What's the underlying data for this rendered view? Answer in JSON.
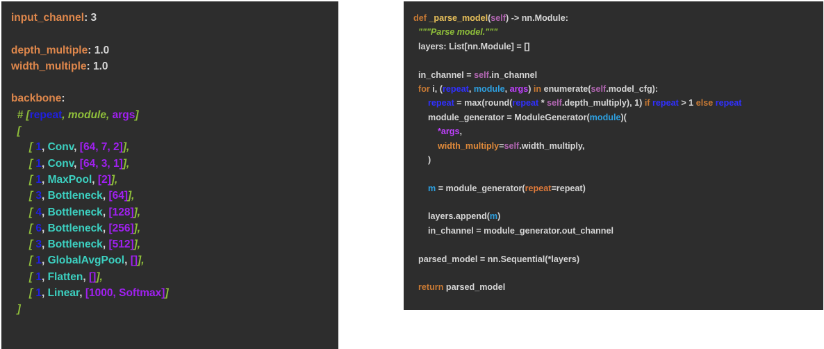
{
  "colors": {
    "panel_bg": "#2d2d2d",
    "key": "#e0884c",
    "text": "#d6d6d6",
    "comment": "#8fbf3a",
    "number": "#2020e0",
    "list": "#a020f0",
    "module": "#3cd0c0"
  },
  "yaml_lines": [
    [
      {
        "t": "input_channel",
        "c": "key"
      },
      {
        "t": ": 3",
        "c": "text"
      }
    ],
    [],
    [
      {
        "t": "depth_multiple",
        "c": "key"
      },
      {
        "t": ": 1.0",
        "c": "text"
      }
    ],
    [
      {
        "t": "width_multiple",
        "c": "key"
      },
      {
        "t": ": 1.0",
        "c": "text"
      }
    ],
    [],
    [
      {
        "t": "backbone",
        "c": "key"
      },
      {
        "t": ":",
        "c": "text"
      }
    ],
    [
      {
        "t": "  # [",
        "c": "comment"
      },
      {
        "t": "repeat",
        "c": "num"
      },
      {
        "t": ", module, ",
        "c": "comment"
      },
      {
        "t": "args",
        "c": "purple"
      },
      {
        "t": "]",
        "c": "comment"
      }
    ],
    [
      {
        "t": "  [",
        "c": "comment"
      }
    ],
    [
      {
        "t": "      [ ",
        "c": "comment"
      },
      {
        "t": "1",
        "c": "num"
      },
      {
        "t": ", ",
        "c": "text"
      },
      {
        "t": "Conv",
        "c": "teal"
      },
      {
        "t": ", ",
        "c": "text"
      },
      {
        "t": "[64, 7, 2]",
        "c": "purple"
      },
      {
        "t": "],",
        "c": "comment"
      }
    ],
    [
      {
        "t": "      [ ",
        "c": "comment"
      },
      {
        "t": "1",
        "c": "num"
      },
      {
        "t": ", ",
        "c": "text"
      },
      {
        "t": "Conv",
        "c": "teal"
      },
      {
        "t": ", ",
        "c": "text"
      },
      {
        "t": "[64, 3, 1]",
        "c": "purple"
      },
      {
        "t": "],",
        "c": "comment"
      }
    ],
    [
      {
        "t": "      [ ",
        "c": "comment"
      },
      {
        "t": "1",
        "c": "num"
      },
      {
        "t": ", ",
        "c": "text"
      },
      {
        "t": "MaxPool",
        "c": "teal"
      },
      {
        "t": ", ",
        "c": "text"
      },
      {
        "t": "[2]",
        "c": "purple"
      },
      {
        "t": "],",
        "c": "comment"
      }
    ],
    [
      {
        "t": "      [ ",
        "c": "comment"
      },
      {
        "t": "3",
        "c": "num"
      },
      {
        "t": ", ",
        "c": "text"
      },
      {
        "t": "Bottleneck",
        "c": "teal"
      },
      {
        "t": ", ",
        "c": "text"
      },
      {
        "t": "[64]",
        "c": "purple"
      },
      {
        "t": "],",
        "c": "comment"
      }
    ],
    [
      {
        "t": "      [ ",
        "c": "comment"
      },
      {
        "t": "4",
        "c": "num"
      },
      {
        "t": ", ",
        "c": "text"
      },
      {
        "t": "Bottleneck",
        "c": "teal"
      },
      {
        "t": ", ",
        "c": "text"
      },
      {
        "t": "[128]",
        "c": "purple"
      },
      {
        "t": "],",
        "c": "comment"
      }
    ],
    [
      {
        "t": "      [ ",
        "c": "comment"
      },
      {
        "t": "6",
        "c": "num"
      },
      {
        "t": ", ",
        "c": "text"
      },
      {
        "t": "Bottleneck",
        "c": "teal"
      },
      {
        "t": ", ",
        "c": "text"
      },
      {
        "t": "[256]",
        "c": "purple"
      },
      {
        "t": "],",
        "c": "comment"
      }
    ],
    [
      {
        "t": "      [ ",
        "c": "comment"
      },
      {
        "t": "3",
        "c": "num"
      },
      {
        "t": ", ",
        "c": "text"
      },
      {
        "t": "Bottleneck",
        "c": "teal"
      },
      {
        "t": ", ",
        "c": "text"
      },
      {
        "t": "[512]",
        "c": "purple"
      },
      {
        "t": "],",
        "c": "comment"
      }
    ],
    [
      {
        "t": "      [ ",
        "c": "comment"
      },
      {
        "t": "1",
        "c": "num"
      },
      {
        "t": ", ",
        "c": "text"
      },
      {
        "t": "GlobalAvgPool",
        "c": "teal"
      },
      {
        "t": ", ",
        "c": "text"
      },
      {
        "t": "[]",
        "c": "purple"
      },
      {
        "t": "],",
        "c": "comment"
      }
    ],
    [
      {
        "t": "      [ ",
        "c": "comment"
      },
      {
        "t": "1",
        "c": "num"
      },
      {
        "t": ", ",
        "c": "text"
      },
      {
        "t": "Flatten",
        "c": "teal"
      },
      {
        "t": ", ",
        "c": "text"
      },
      {
        "t": "[]",
        "c": "purple"
      },
      {
        "t": "],",
        "c": "comment"
      }
    ],
    [
      {
        "t": "      [ ",
        "c": "comment"
      },
      {
        "t": "1",
        "c": "num"
      },
      {
        "t": ", ",
        "c": "text"
      },
      {
        "t": "Linear",
        "c": "teal"
      },
      {
        "t": ", ",
        "c": "text"
      },
      {
        "t": "[1000, Softmax]",
        "c": "purple"
      },
      {
        "t": "]",
        "c": "comment"
      }
    ],
    [
      {
        "t": "  ]",
        "c": "comment"
      }
    ]
  ],
  "code_lines": [
    [
      {
        "t": "def ",
        "c": "kw"
      },
      {
        "t": "_parse_model",
        "c": "gold"
      },
      {
        "t": "(",
        "c": "text"
      },
      {
        "t": "self",
        "c": "self"
      },
      {
        "t": ") -> nn.Module:",
        "c": "text"
      }
    ],
    [
      {
        "t": "  \"\"\"Parse model.\"\"\"",
        "c": "str"
      }
    ],
    [
      {
        "t": "  layers: List[nn.Module] = []",
        "c": "text"
      }
    ],
    [],
    [
      {
        "t": "  in_channel = ",
        "c": "text"
      },
      {
        "t": "self",
        "c": "self"
      },
      {
        "t": ".in_channel",
        "c": "text"
      }
    ],
    [
      {
        "t": "  for ",
        "c": "kw"
      },
      {
        "t": "i, (",
        "c": "text"
      },
      {
        "t": "repeat",
        "c": "deep"
      },
      {
        "t": ", ",
        "c": "text"
      },
      {
        "t": "module",
        "c": "blue"
      },
      {
        "t": ", ",
        "c": "text"
      },
      {
        "t": "args",
        "c": "vio"
      },
      {
        "t": ") ",
        "c": "text"
      },
      {
        "t": "in ",
        "c": "kw"
      },
      {
        "t": "enumerate(",
        "c": "text"
      },
      {
        "t": "self",
        "c": "self"
      },
      {
        "t": ".model_cfg):",
        "c": "text"
      }
    ],
    [
      {
        "t": "      ",
        "c": "text"
      },
      {
        "t": "repeat",
        "c": "deep"
      },
      {
        "t": " = max(round(",
        "c": "text"
      },
      {
        "t": "repeat",
        "c": "deep"
      },
      {
        "t": " * ",
        "c": "text"
      },
      {
        "t": "self",
        "c": "self"
      },
      {
        "t": ".depth_multiply), 1) ",
        "c": "text"
      },
      {
        "t": "if ",
        "c": "kw"
      },
      {
        "t": "repeat",
        "c": "deep"
      },
      {
        "t": " > 1 ",
        "c": "text"
      },
      {
        "t": "else ",
        "c": "kw"
      },
      {
        "t": "repeat",
        "c": "deep"
      }
    ],
    [
      {
        "t": "      module_generator = ModuleGenerator(",
        "c": "text"
      },
      {
        "t": "module",
        "c": "blue"
      },
      {
        "t": ")(",
        "c": "text"
      }
    ],
    [
      {
        "t": "          ",
        "c": "text"
      },
      {
        "t": "*args",
        "c": "vio"
      },
      {
        "t": ",",
        "c": "text"
      }
    ],
    [
      {
        "t": "          ",
        "c": "text"
      },
      {
        "t": "width_multiply",
        "c": "kwarg"
      },
      {
        "t": "=",
        "c": "text"
      },
      {
        "t": "self",
        "c": "self"
      },
      {
        "t": ".width_multiply,",
        "c": "text"
      }
    ],
    [
      {
        "t": "      )",
        "c": "text"
      }
    ],
    [],
    [
      {
        "t": "      ",
        "c": "text"
      },
      {
        "t": "m",
        "c": "blue"
      },
      {
        "t": " = module_generator(",
        "c": "text"
      },
      {
        "t": "repeat",
        "c": "orange"
      },
      {
        "t": "=repeat)",
        "c": "text"
      }
    ],
    [],
    [
      {
        "t": "      layers.append(",
        "c": "text"
      },
      {
        "t": "m",
        "c": "blue"
      },
      {
        "t": ")",
        "c": "text"
      }
    ],
    [
      {
        "t": "      in_channel = module_generator.out_channel",
        "c": "text"
      }
    ],
    [],
    [
      {
        "t": "  parsed_model = nn.Sequential(*layers)",
        "c": "text"
      }
    ],
    [],
    [
      {
        "t": "  return ",
        "c": "kw"
      },
      {
        "t": "parsed_model",
        "c": "text"
      }
    ]
  ]
}
